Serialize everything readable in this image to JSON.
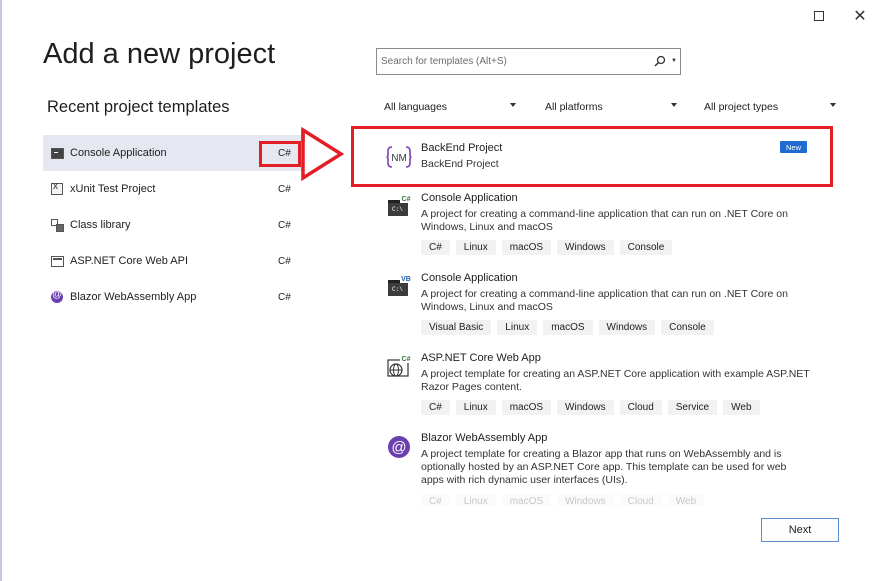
{
  "window": {
    "maximize_icon": "maximize-icon",
    "close_icon": "close-icon",
    "close_glyph": "✕"
  },
  "page_title": "Add a new project",
  "recent": {
    "title": "Recent project templates",
    "items": [
      {
        "label": "Console Application",
        "lang": "C#",
        "icon": "console-icon"
      },
      {
        "label": "xUnit Test Project",
        "lang": "C#",
        "icon": "xunit-icon"
      },
      {
        "label": "Class library",
        "lang": "C#",
        "icon": "class-library-icon"
      },
      {
        "label": "ASP.NET Core Web API",
        "lang": "C#",
        "icon": "web-api-icon"
      },
      {
        "label": "Blazor WebAssembly App",
        "lang": "C#",
        "icon": "blazor-icon"
      }
    ]
  },
  "search": {
    "placeholder": "Search for templates (Alt+S)",
    "icon": "search-icon"
  },
  "filters": {
    "languages": "All languages",
    "platforms": "All platforms",
    "project_types": "All project types"
  },
  "templates": [
    {
      "name": "BackEnd Project",
      "description": "BackEnd Project",
      "badge": "New",
      "icon_text": "NM",
      "tags": []
    },
    {
      "name": "Console Application",
      "description": "A project for creating a command-line application that can run on .NET Core on Windows, Linux and macOS",
      "icon_lang": "C#",
      "tags": [
        "C#",
        "Linux",
        "macOS",
        "Windows",
        "Console"
      ]
    },
    {
      "name": "Console Application",
      "description": "A project for creating a command-line application that can run on .NET Core on Windows, Linux and macOS",
      "icon_lang": "VB",
      "tags": [
        "Visual Basic",
        "Linux",
        "macOS",
        "Windows",
        "Console"
      ]
    },
    {
      "name": "ASP.NET Core Web App",
      "description": "A project template for creating an ASP.NET Core application with example ASP.NET Razor Pages content.",
      "icon_lang": "C#",
      "tags": [
        "C#",
        "Linux",
        "macOS",
        "Windows",
        "Cloud",
        "Service",
        "Web"
      ]
    },
    {
      "name": "Blazor WebAssembly App",
      "description": "A project template for creating a Blazor app that runs on WebAssembly and is optionally hosted by an ASP.NET Core app. This template can be used for web apps with rich dynamic user interfaces (UIs).",
      "tags": [
        "C#",
        "Linux",
        "macOS",
        "Windows",
        "Cloud",
        "Web"
      ]
    }
  ],
  "next_label": "Next",
  "colors": {
    "highlight_red": "#e41e26",
    "selected_bg": "#e5e8f0",
    "badge_blue": "#1f6bd1",
    "blazor_purple": "#6c3fb0"
  }
}
